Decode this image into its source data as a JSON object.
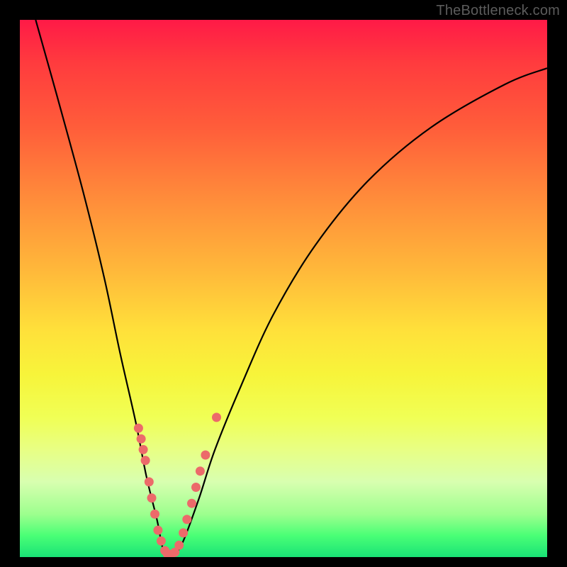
{
  "watermark": "TheBottleneck.com",
  "chart_data": {
    "type": "line",
    "title": "",
    "xlabel": "",
    "ylabel": "",
    "xlim": [
      0,
      100
    ],
    "ylim": [
      0,
      100
    ],
    "grid": false,
    "legend": false,
    "curve": [
      {
        "x": 3,
        "y": 100
      },
      {
        "x": 7,
        "y": 86
      },
      {
        "x": 12,
        "y": 68
      },
      {
        "x": 16,
        "y": 52
      },
      {
        "x": 19,
        "y": 38
      },
      {
        "x": 22,
        "y": 25
      },
      {
        "x": 24,
        "y": 15
      },
      {
        "x": 26,
        "y": 7
      },
      {
        "x": 27,
        "y": 2
      },
      {
        "x": 28,
        "y": 0
      },
      {
        "x": 29,
        "y": 0
      },
      {
        "x": 31,
        "y": 3
      },
      {
        "x": 34,
        "y": 11
      },
      {
        "x": 37,
        "y": 20
      },
      {
        "x": 42,
        "y": 32
      },
      {
        "x": 48,
        "y": 45
      },
      {
        "x": 56,
        "y": 58
      },
      {
        "x": 66,
        "y": 70
      },
      {
        "x": 78,
        "y": 80
      },
      {
        "x": 92,
        "y": 88
      },
      {
        "x": 100,
        "y": 91
      }
    ],
    "series": [
      {
        "name": "markers",
        "points": [
          {
            "x": 22.5,
            "y": 24
          },
          {
            "x": 23.0,
            "y": 22
          },
          {
            "x": 23.4,
            "y": 20
          },
          {
            "x": 23.8,
            "y": 18
          },
          {
            "x": 24.5,
            "y": 14
          },
          {
            "x": 25.0,
            "y": 11
          },
          {
            "x": 25.6,
            "y": 8
          },
          {
            "x": 26.2,
            "y": 5
          },
          {
            "x": 26.8,
            "y": 3
          },
          {
            "x": 27.5,
            "y": 1.2
          },
          {
            "x": 28.0,
            "y": 0.6
          },
          {
            "x": 28.7,
            "y": 0.5
          },
          {
            "x": 29.4,
            "y": 0.9
          },
          {
            "x": 30.2,
            "y": 2.2
          },
          {
            "x": 31.0,
            "y": 4.5
          },
          {
            "x": 31.7,
            "y": 7
          },
          {
            "x": 32.6,
            "y": 10
          },
          {
            "x": 33.4,
            "y": 13
          },
          {
            "x": 34.2,
            "y": 16
          },
          {
            "x": 35.2,
            "y": 19
          },
          {
            "x": 37.3,
            "y": 26
          }
        ]
      }
    ],
    "marker_color": "#ec6a6a"
  }
}
